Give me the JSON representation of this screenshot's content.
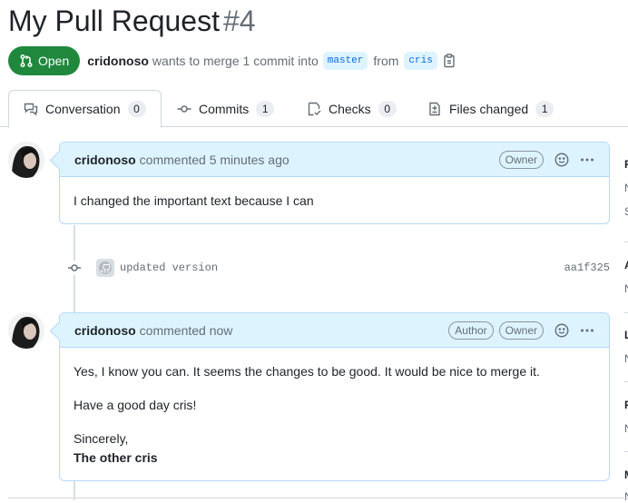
{
  "pr": {
    "title": "My Pull Request",
    "number": "#4",
    "state": "Open",
    "author": "cridonoso",
    "merge_text": "wants to merge 1 commit into",
    "base_branch": "master",
    "from_text": "from",
    "head_branch": "cris"
  },
  "tabs": [
    {
      "label": "Conversation",
      "count": "0",
      "icon": "comment-discussion-icon"
    },
    {
      "label": "Commits",
      "count": "1",
      "icon": "git-commit-icon"
    },
    {
      "label": "Checks",
      "count": "0",
      "icon": "checklist-icon"
    },
    {
      "label": "Files changed",
      "count": "1",
      "icon": "file-diff-icon"
    }
  ],
  "comments": [
    {
      "author": "cridonoso",
      "action": "commented 5 minutes ago",
      "roles": [
        "Owner"
      ],
      "body": [
        "I changed the important text because I can"
      ]
    },
    {
      "author": "cridonoso",
      "action": "commented now",
      "roles": [
        "Author",
        "Owner"
      ],
      "body": [
        "Yes, I know you can. It seems the changes to be good. It would be nice to merge it.",
        "Have a good day cris!",
        "Sincerely,"
      ],
      "signature": "The other cris"
    }
  ],
  "commit": {
    "message": "updated version",
    "sha": "aa1f325"
  },
  "sidebar_fragments": [
    "R",
    "N",
    "S",
    "A",
    "N",
    "L",
    "N",
    "P",
    "N",
    "M",
    "N"
  ],
  "colors": {
    "open_green": "#1f883d",
    "header_blue": "#ddf4ff",
    "border_blue": "#b6d9f7",
    "link_blue": "#0969da"
  }
}
